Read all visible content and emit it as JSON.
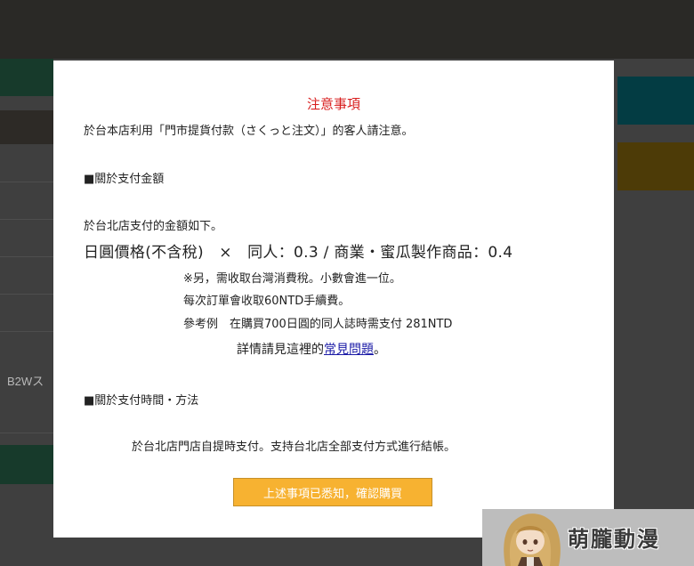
{
  "background": {
    "fragment_text": "B2Wス"
  },
  "modal": {
    "title": "注意事項",
    "intro": "於台本店利用「門市提貨付款（さくっと注文）」的客人請注意。",
    "section1_heading": "■關於支付金額",
    "amount_intro": "於台北店支付的金額如下。",
    "formula": "日圓價格(不含稅)　×　同人：0.3 / 商業・蜜瓜製作商品：0.4",
    "note_tax": "※另，需收取台灣消費稅。小數會進一位。",
    "note_fee": "每次訂單會收取60NTD手續費。",
    "example": "參考例　在購買700日圓的同人誌時需支付 281NTD",
    "details_prefix": "詳情請見這裡的",
    "details_link": "常見問題",
    "details_suffix": "。",
    "section2_heading": "■關於支付時間・方法",
    "payment_info": "於台北店門店自提時支付。支持台北店全部支付方式進行結帳。",
    "confirm_label": "上述事項已悉知，確認購買"
  },
  "watermark": {
    "text": "萌朧動漫"
  },
  "colors": {
    "title_red": "#d81e1e",
    "button_orange": "#f7b231",
    "link_blue": "#1a1aa6"
  }
}
